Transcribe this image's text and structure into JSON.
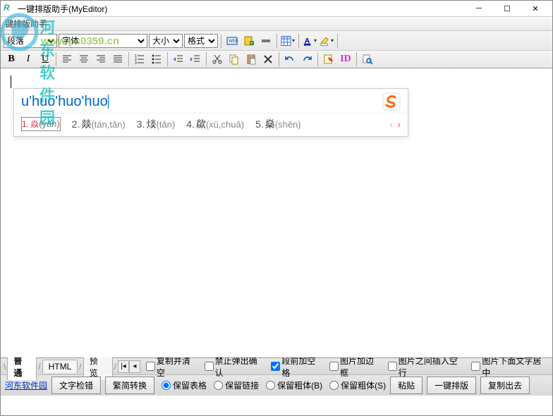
{
  "window": {
    "title": "一键排版助手(MyEditor)"
  },
  "watermark": {
    "text1": "河东软件园",
    "text2": "www.pc0359.cn"
  },
  "header2": "键排版助手",
  "toolbar1": {
    "paragraph_label": "段落",
    "font_label": "字体",
    "size_label": "大小",
    "format_label": "格式"
  },
  "ime": {
    "input": "u'huo'huo'huo",
    "candidates": [
      {
        "n": "1.",
        "char": "焱",
        "py": "(yàn)"
      },
      {
        "n": "2.",
        "char": "燚",
        "py": "(tán,tǎn)"
      },
      {
        "n": "3.",
        "char": "㷋",
        "py": "(tǎn)"
      },
      {
        "n": "4.",
        "char": "歘",
        "py": "(xū,chuā)"
      },
      {
        "n": "5.",
        "char": "燊",
        "py": "(shēn)"
      }
    ]
  },
  "tabs": {
    "t1": "普通",
    "t2": "HTML",
    "t3": "预览",
    "chk1": "复制并清空",
    "chk2": "禁止弹出确认",
    "chk3": "段前加空格",
    "chk4": "图片加边框",
    "chk5": "图片之间插入空行",
    "chk6": "图片下面文字居中"
  },
  "bottom": {
    "link": "河东软件园",
    "b1": "文字检错",
    "b2": "繁简转换",
    "r1": "保留表格",
    "r2": "保留链接",
    "r3": "保留粗体(B)",
    "r4": "保留粗体(S)",
    "b3": "粘贴",
    "b4": "一键排版",
    "b5": "复制出去"
  }
}
